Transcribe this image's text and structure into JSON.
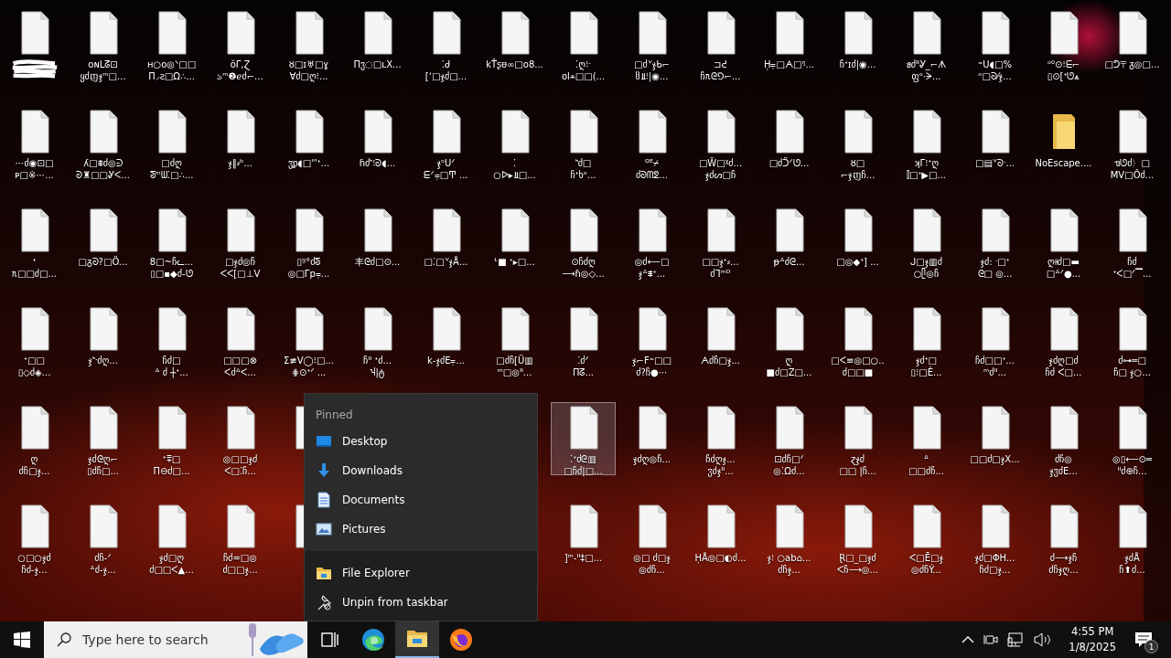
{
  "desktop": {
    "rows": [
      {
        "left": [
          {
            "kind": "file",
            "selected": false,
            "redacted": true
          },
          {
            "kind": "file",
            "selected": false,
            "label": "oɴᒪᘔ⊡\nყძញჯᵐ□..."
          },
          {
            "kind": "file",
            "selected": false,
            "label": "ʜ○o◎ᐠ□□\nΠ⸝ƨ□Ω∴..."
          },
          {
            "kind": "file",
            "selected": false,
            "label": "ŏᒥ,Ɀ\nঌᵐ❷ℯძ⌐..."
          },
          {
            "kind": "file",
            "selected": false,
            "label": "ȣ□ɪ♅□ɣ\nⱯძ□ღ⁝..."
          },
          {
            "kind": "file",
            "selected": false,
            "label": "Πჳ◌□ʟX..."
          },
          {
            "kind": "file",
            "selected": false,
            "label": "⁚ᑯ\n[ʼ□ჯძ□..."
          },
          {
            "kind": "file",
            "selected": false,
            "label": "kŤʂᵿ∞□o8..."
          },
          {
            "kind": "file",
            "selected": false,
            "label": "⁚ღ⁝ᐧ\nol⩡□□(..."
          },
          {
            "kind": "file",
            "selected": false,
            "label": "□ძᘁჯᑲ⌐\nჱ⫫⁝|◉..."
          },
          {
            "kind": "file",
            "selected": false,
            "label": "⊐ᕍ\nჩᥰᘓ⅁⌐..."
          },
          {
            "kind": "file",
            "selected": false,
            "label": "Ḥ⩦□ᗅ□ᵑ..."
          },
          {
            "kind": "file",
            "selected": false,
            "label": "ჩᐩɪძ|◉..."
          },
          {
            "kind": "file",
            "selected": false,
            "label": "ᥑძᐦᎽ_⌐ᗑ\nფᵒ·ᗒ..."
          },
          {
            "kind": "file",
            "selected": false,
            "label": "⁼ᑌ◖□%\nᵒ□ᘐ⁄ჯ..."
          },
          {
            "kind": "file",
            "selected": false,
            "label": "ᵒ⁰⊙⁝ᗴ⌐\n▯⊙[ᐩᘎ⩓"
          },
          {
            "kind": "file",
            "selected": false,
            "label": "□ᕤ〒ᵹ◎□..."
          }
        ]
      },
      {
        "left": [
          {
            "kind": "file",
            "selected": false,
            "label": "⋯ძ◉⊡□\nᴘ□※⋯..."
          },
          {
            "kind": "file",
            "selected": false,
            "label": "ʎ□⩨ძ◎ᕭ\nᘐ♜□□Ꮍᐸ..."
          },
          {
            "kind": "file",
            "selected": false,
            "label": "□ძღ\nᘕᵐᗯ⁚□∴..."
          },
          {
            "kind": "file",
            "selected": false,
            "label": "ჯ‖⸗ᵇ..."
          },
          {
            "kind": "file",
            "selected": false,
            "label": "ჳᵱ◖□ᔥᐩ..."
          },
          {
            "kind": "file",
            "selected": false,
            "label": "ɦძᑋ⁝ᘐ◖..."
          },
          {
            "kind": "file",
            "selected": false,
            "label": "ჯᵒᑌᐟ\nᗴᐟ⩦□Ͳ ..."
          },
          {
            "kind": "file",
            "selected": false,
            "label": "⁚\n○ᐅ▸⫫□..."
          },
          {
            "kind": "file",
            "selected": false,
            "label": "ᑋძ□\nჩᐩხᵒ..."
          },
          {
            "kind": "file",
            "selected": false,
            "label": "ᴼᴱ⌿\nძᘐᗰᘖ..."
          },
          {
            "kind": "file",
            "selected": false,
            "label": "□Ẅ□ᵡძ...\nჯძᔕ□ჩ"
          },
          {
            "kind": "file",
            "selected": false,
            "label": "□ძᑒᐟᘎ..."
          },
          {
            "kind": "file",
            "selected": false,
            "label": "ȣ□\n⌐ჯញჩ..."
          },
          {
            "kind": "file",
            "selected": false,
            "label": "ʞΓ⁝ᐩღ\n⫿□ᐩ▶□..."
          },
          {
            "kind": "file",
            "selected": false,
            "label": "□▤ᘁᘐᐧ..."
          },
          {
            "kind": "folder",
            "selected": false,
            "label": "NoEscape...."
          },
          {
            "kind": "file",
            "selected": false,
            "label": "ᥓᘎძ〉□\nMᐯ□Ôძ..."
          }
        ]
      },
      {
        "left": [
          {
            "kind": "file",
            "selected": false,
            "label": "ᐩ\nᥰ□□ძ□..."
          },
          {
            "kind": "file",
            "selected": false,
            "label": "□ᵹᘐ?□Ö..."
          },
          {
            "kind": "file",
            "selected": false,
            "label": "8□~ჩᓚ...\n▯□▪◆ძ-ᘎ"
          },
          {
            "kind": "file",
            "selected": false,
            "label": "□ჯძ◎ჩ\nᐸᐸ[□⊥V"
          },
          {
            "kind": "file",
            "selected": false,
            "label": "▯ᵍ°ძᘕ\n◎□Γp⩦..."
          },
          {
            "kind": "file",
            "selected": false,
            "label": "丰ᘓძ□⊙..."
          },
          {
            "kind": "file",
            "selected": false,
            "label": "□⁚□ᘁჯÅ..."
          },
          {
            "kind": "file",
            "selected": false,
            "label": "ᒻ■ ᐩ▸□..."
          },
          {
            "kind": "file",
            "selected": false,
            "label": "⊙ჩძღ\n⟶ɦ◎◇..."
          },
          {
            "kind": "file",
            "selected": false,
            "label": "◎ძ⟵□\nჯᐞ⩨ᐩ..."
          },
          {
            "kind": "file",
            "selected": false,
            "label": "□□ჯᐩ⸗...\nძᒣᵐᴰ"
          },
          {
            "kind": "file",
            "selected": false,
            "label": "ᵽᐞძᘓ..."
          },
          {
            "kind": "file",
            "selected": false,
            "label": "□◎◆ᐩ] ..."
          },
          {
            "kind": "file",
            "selected": false,
            "label": "ᒍ□ჯ▥ძ\n○ᥫ◎ჩ"
          },
          {
            "kind": "file",
            "selected": false,
            "label": "ჯძ: ᐧ□ᐩ\nᘓ□ ◎..."
          },
          {
            "kind": "file",
            "selected": false,
            "label": "ღ⫲ძ□▬\n□ᐞᐟ●..."
          },
          {
            "kind": "file",
            "selected": false,
            "label": "ჩძ\nᐩᐸ□ᐟ▔..."
          }
        ]
      },
      {
        "left": [
          {
            "kind": "file",
            "selected": false,
            "label": "ᐩ□□\n▯◇ძ◈..."
          },
          {
            "kind": "file",
            "selected": false,
            "label": "ჯᑋᐧძღ..."
          },
          {
            "kind": "file",
            "selected": false,
            "label": "ჩძ□\nᐞ ძ ┼ᐩ..."
          },
          {
            "kind": "file",
            "selected": false,
            "label": "□□□⊗\nᐸძᐞᐸ..."
          },
          {
            "kind": "file",
            "selected": false,
            "label": "Σ≢V◯⁝□...\n⋕⊙ᐩᐟ ..."
          },
          {
            "kind": "file",
            "selected": false,
            "label": "ჩᐦ ᐩძ...\nჃ|ტ"
          },
          {
            "kind": "file",
            "selected": false,
            "label": "k-ჯძE⩦..."
          },
          {
            "kind": "file",
            "selected": false,
            "label": "□ძჩ[Ü▥\nᵐ□◎ᐦ..."
          },
          {
            "kind": "file",
            "selected": false,
            "label": "⁚ძᐟ\nΠᘔ..."
          },
          {
            "kind": "file",
            "selected": false,
            "label": "ჯ⌐F⁼□□\nძ?ჩ●⋯"
          },
          {
            "kind": "file",
            "selected": false,
            "label": "ᗅძჩ□ჯ..."
          },
          {
            "kind": "file",
            "selected": false,
            "label": "ღ\n■ძ□Z□..."
          },
          {
            "kind": "file",
            "selected": false,
            "label": "□ᐸ≡◎□○..\nძ□□■"
          },
          {
            "kind": "file",
            "selected": false,
            "label": "ჯძᐩ□\n▯⁝□Ė..."
          },
          {
            "kind": "file",
            "selected": false,
            "label": "ჩძ□□ᐩ...\nᵐძᐦ..."
          },
          {
            "kind": "file",
            "selected": false,
            "label": "ჯძღ□ძ\nჩძ ᐸ□..."
          },
          {
            "kind": "file",
            "selected": false,
            "label": "ძ⊶═□\nჩ□ ჯ○..."
          }
        ]
      },
      {
        "left": [
          {
            "kind": "file",
            "selected": false,
            "label": "ღ\nძჩ□ჯ..."
          },
          {
            "kind": "file",
            "selected": false,
            "label": "ჯძᘓღ⌐\n▯ძჩ□..."
          },
          {
            "kind": "file",
            "selected": false,
            "label": "ᐩ⩱□\nΠ⊖ძ□..."
          },
          {
            "kind": "file",
            "selected": false,
            "label": "◎□□ჯძ\nᐸ□⁚ჩ..."
          },
          {
            "kind": "file",
            "selected": false
          }
        ],
        "right": [
          {
            "kind": "file",
            "selected": true,
            "label": "⁚ᐩძᘓ▥\n□ჩძ|□..."
          },
          {
            "kind": "file",
            "selected": false,
            "label": "ჯძღ◎ჩ..."
          },
          {
            "kind": "file",
            "selected": false,
            "label": "ჩძღჯ...\nჳძჯᐦ..."
          },
          {
            "kind": "file",
            "selected": false,
            "label": "⊡ძჩ□ᐟ\n◎⁚Ωძ..."
          },
          {
            "kind": "file",
            "selected": false,
            "label": "ɀჯძ\n□□ |ჩ..."
          },
          {
            "kind": "file",
            "selected": false,
            "label": "ᐞ\n□□ძჩ..."
          },
          {
            "kind": "file",
            "selected": false,
            "label": "□□ძ□ჯX..."
          },
          {
            "kind": "file",
            "selected": false,
            "label": "ძჩ◎\nჯჳძE..."
          },
          {
            "kind": "file",
            "selected": false,
            "label": "◎▯⟵⊙═\nᐦძ⊕ჩ..."
          }
        ]
      },
      {
        "left": [
          {
            "kind": "file",
            "selected": false,
            "label": "○□○ჯძ\nჩძ-ჯ..."
          },
          {
            "kind": "file",
            "selected": false,
            "label": "ძჩ-ᐟ\nᐞძ-ჯ..."
          },
          {
            "kind": "file",
            "selected": false,
            "label": "ჯძ□ღ\nძ□□ᐸ▲..."
          },
          {
            "kind": "file",
            "selected": false,
            "label": "ჩძ=□◎\nძ□□ჯ..."
          },
          {
            "kind": "file",
            "selected": false
          }
        ],
        "right": [
          {
            "kind": "file",
            "selected": false,
            "label": "]ᵐ-ᐦ‡□..."
          },
          {
            "kind": "file",
            "selected": false,
            "label": "◎□ ძ□ჯ\n◎ძჩ..."
          },
          {
            "kind": "file",
            "selected": false,
            "label": "ḤÅ◎□◐ძ..."
          },
          {
            "kind": "file",
            "selected": false,
            "label": "ჯ⁝ ○ab⌂...\nძჩჯ..."
          },
          {
            "kind": "file",
            "selected": false,
            "label": "Ɽ□_□ჯძ\nᐸჩ⟶◎..."
          },
          {
            "kind": "file",
            "selected": false,
            "label": "ᐸ□Ē□ჯ\n◎ძჩÝ..."
          },
          {
            "kind": "file",
            "selected": false,
            "label": "ჯძ□ΦH...\nჩძ□ჯ..."
          },
          {
            "kind": "file",
            "selected": false,
            "label": "ძ⟶ჯჩ\nძჩჯღ..."
          },
          {
            "kind": "file",
            "selected": false,
            "label": "ჯძÅ\nჩ⬆ძ..."
          }
        ]
      }
    ]
  },
  "jump_list": {
    "section_title": "Pinned",
    "pinned": [
      {
        "kind": "desktop",
        "label": "Desktop"
      },
      {
        "kind": "downloads",
        "label": "Downloads"
      },
      {
        "kind": "documents",
        "label": "Documents"
      },
      {
        "kind": "pictures",
        "label": "Pictures"
      }
    ],
    "actions": [
      {
        "kind": "explorer",
        "label": "File Explorer"
      },
      {
        "kind": "unpin",
        "label": "Unpin from taskbar"
      }
    ]
  },
  "taskbar": {
    "search": {
      "placeholder": "Type here to search"
    },
    "apps": [
      {
        "kind": "task-view",
        "active": false
      },
      {
        "kind": "edge",
        "active": false
      },
      {
        "kind": "explorer",
        "active": true
      },
      {
        "kind": "firefox",
        "active": false
      }
    ],
    "clock": {
      "time": "4:55 PM",
      "date": "1/8/2025"
    },
    "notification_count": "1"
  }
}
